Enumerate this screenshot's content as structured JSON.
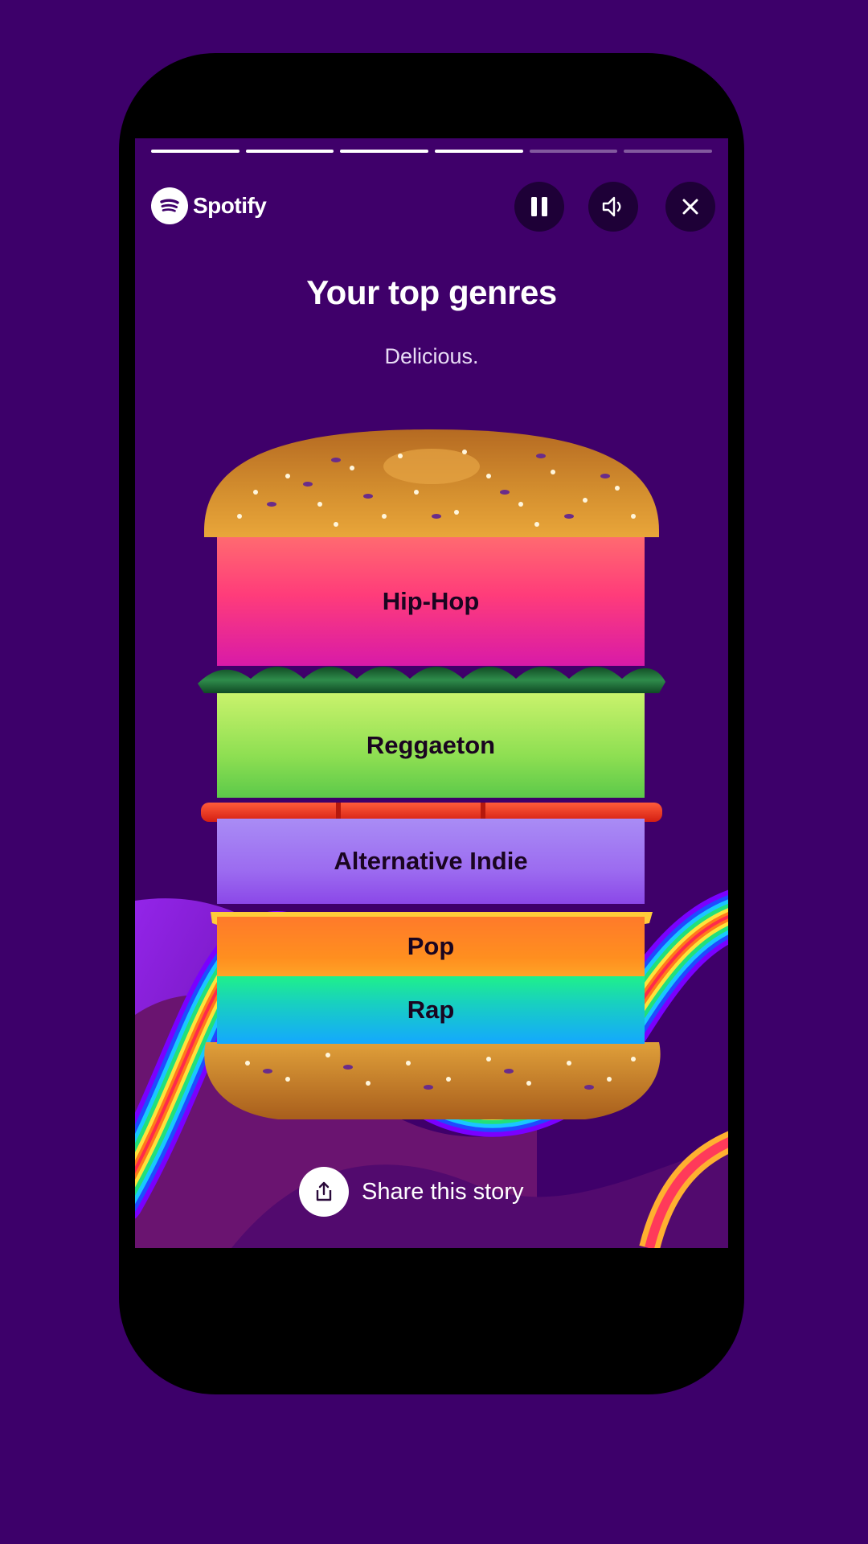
{
  "app": {
    "brand": "Spotify"
  },
  "story": {
    "progress_segments": [
      true,
      true,
      true,
      true,
      false,
      false
    ],
    "title": "Your top genres",
    "subtitle": "Delicious.",
    "genres": [
      "Hip-Hop",
      "Reggaeton",
      "Alternative Indie",
      "Pop",
      "Rap"
    ]
  },
  "controls": {
    "pause_icon": "pause-icon",
    "sound_icon": "sound-icon",
    "close_icon": "close-icon"
  },
  "share": {
    "label": "Share this story",
    "icon": "share-icon"
  },
  "colors": {
    "background": "#3d006a",
    "screen": "#3f006a",
    "bun": "#c9822c",
    "lettuce": "#1f6a3a",
    "tomato": "#e8301e",
    "cheese": "#ffcc3a"
  }
}
